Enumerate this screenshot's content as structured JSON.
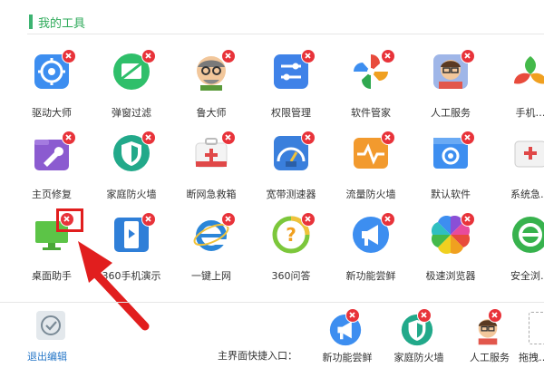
{
  "section": {
    "title": "我的工具"
  },
  "tools": [
    {
      "label": "驱动大师",
      "icon": "driver-gear-icon",
      "color": "#3d8ef0"
    },
    {
      "label": "弹窗过滤",
      "icon": "popup-filter-icon",
      "color": "#2fbf6a"
    },
    {
      "label": "鲁大师",
      "icon": "ludashi-face-icon",
      "color": "#e6a35a"
    },
    {
      "label": "权限管理",
      "icon": "permission-sliders-icon",
      "color": "#3f82e8"
    },
    {
      "label": "软件管家",
      "icon": "software-pinwheel-icon",
      "color": "#f0a020"
    },
    {
      "label": "人工服务",
      "icon": "person-service-icon",
      "color": "#e0b24f"
    },
    {
      "label": "手机…",
      "icon": "phone-leaf-icon",
      "color": "#44b94a"
    },
    {
      "label": "主页修复",
      "icon": "wrench-folder-icon",
      "color": "#8b5bd0"
    },
    {
      "label": "家庭防火墙",
      "icon": "shield-icon",
      "color": "#22a98a"
    },
    {
      "label": "断网急救箱",
      "icon": "first-aid-kit-icon",
      "color": "#e04848"
    },
    {
      "label": "宽带测速器",
      "icon": "speed-gauge-icon",
      "color": "#3a7fdc"
    },
    {
      "label": "流量防火墙",
      "icon": "traffic-wave-icon",
      "color": "#f29a2e"
    },
    {
      "label": "默认软件",
      "icon": "default-gear-icon",
      "color": "#3d8ef0"
    },
    {
      "label": "系统急…",
      "icon": "system-kit-icon",
      "color": "#cccccc"
    },
    {
      "label": "桌面助手",
      "icon": "monitor-icon",
      "color": "#5cc447"
    },
    {
      "label": "360手机演示",
      "icon": "phone-play-icon",
      "color": "#2f7fd8"
    },
    {
      "label": "一键上网",
      "icon": "ie-browser-icon",
      "color": "#2b86d8"
    },
    {
      "label": "360问答",
      "icon": "question-circle-icon",
      "color": "#7cc73b"
    },
    {
      "label": "新功能尝鲜",
      "icon": "megaphone-icon",
      "color": "#3d8ef0"
    },
    {
      "label": "极速浏览器",
      "icon": "browser-petal-icon",
      "color": "#e55b4a"
    },
    {
      "label": "安全浏…",
      "icon": "safe-browser-icon",
      "color": "#37b24d"
    }
  ],
  "footer": {
    "exit_label": "退出编辑",
    "quick_entry_label": "主界面快捷入口：",
    "quick_tools": [
      {
        "label": "新功能尝鲜",
        "icon": "megaphone-icon"
      },
      {
        "label": "家庭防火墙",
        "icon": "shield-icon"
      },
      {
        "label": "人工服务",
        "icon": "person-service-icon"
      },
      {
        "label": "拖拽…",
        "icon": "drag-slot-icon"
      }
    ]
  },
  "colors": {
    "accent": "#2eaa5a",
    "delete": "#e8333a",
    "annotation": "#e11e1e",
    "link": "#2878c8"
  }
}
